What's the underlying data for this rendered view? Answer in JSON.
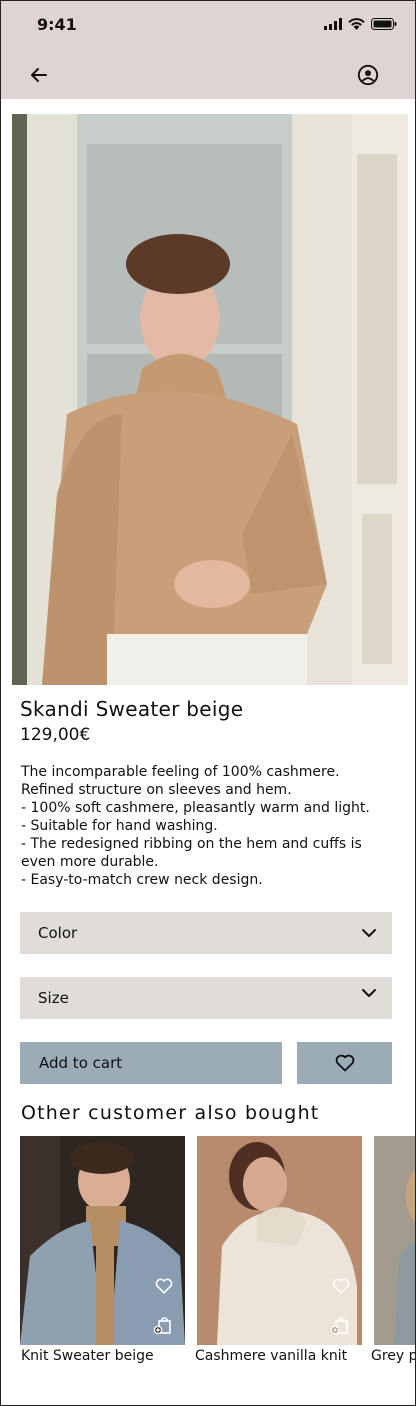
{
  "status": {
    "time": "9:41"
  },
  "colors": {
    "topbar": "#e0d4d3",
    "select_bg": "#e0ddd8",
    "button_bg": "#9bacb6"
  },
  "nav": {
    "back_icon": "arrow-left-icon",
    "profile_icon": "user-circle-icon"
  },
  "product": {
    "title": "Skandi Sweater beige",
    "price": "129,00€",
    "description": [
      "The incomparable feeling of 100% cashmere.",
      "Refined structure on sleeves and hem.",
      "- 100% soft cashmere, pleasantly warm and light.",
      "- Suitable for hand washing.",
      "- The redesigned ribbing on the hem and cuffs is",
      "even more durable.",
      "- Easy-to-match crew neck design."
    ]
  },
  "options": {
    "color_label": "Color",
    "size_label": "Size"
  },
  "actions": {
    "add_to_cart": "Add to cart",
    "wishlist_icon": "heart-icon"
  },
  "recommendations": {
    "title": "Other customer also bought",
    "items": [
      {
        "name": "Knit Sweater beige"
      },
      {
        "name": "Cashmere vanilla knit"
      },
      {
        "name": "Grey p"
      }
    ]
  }
}
